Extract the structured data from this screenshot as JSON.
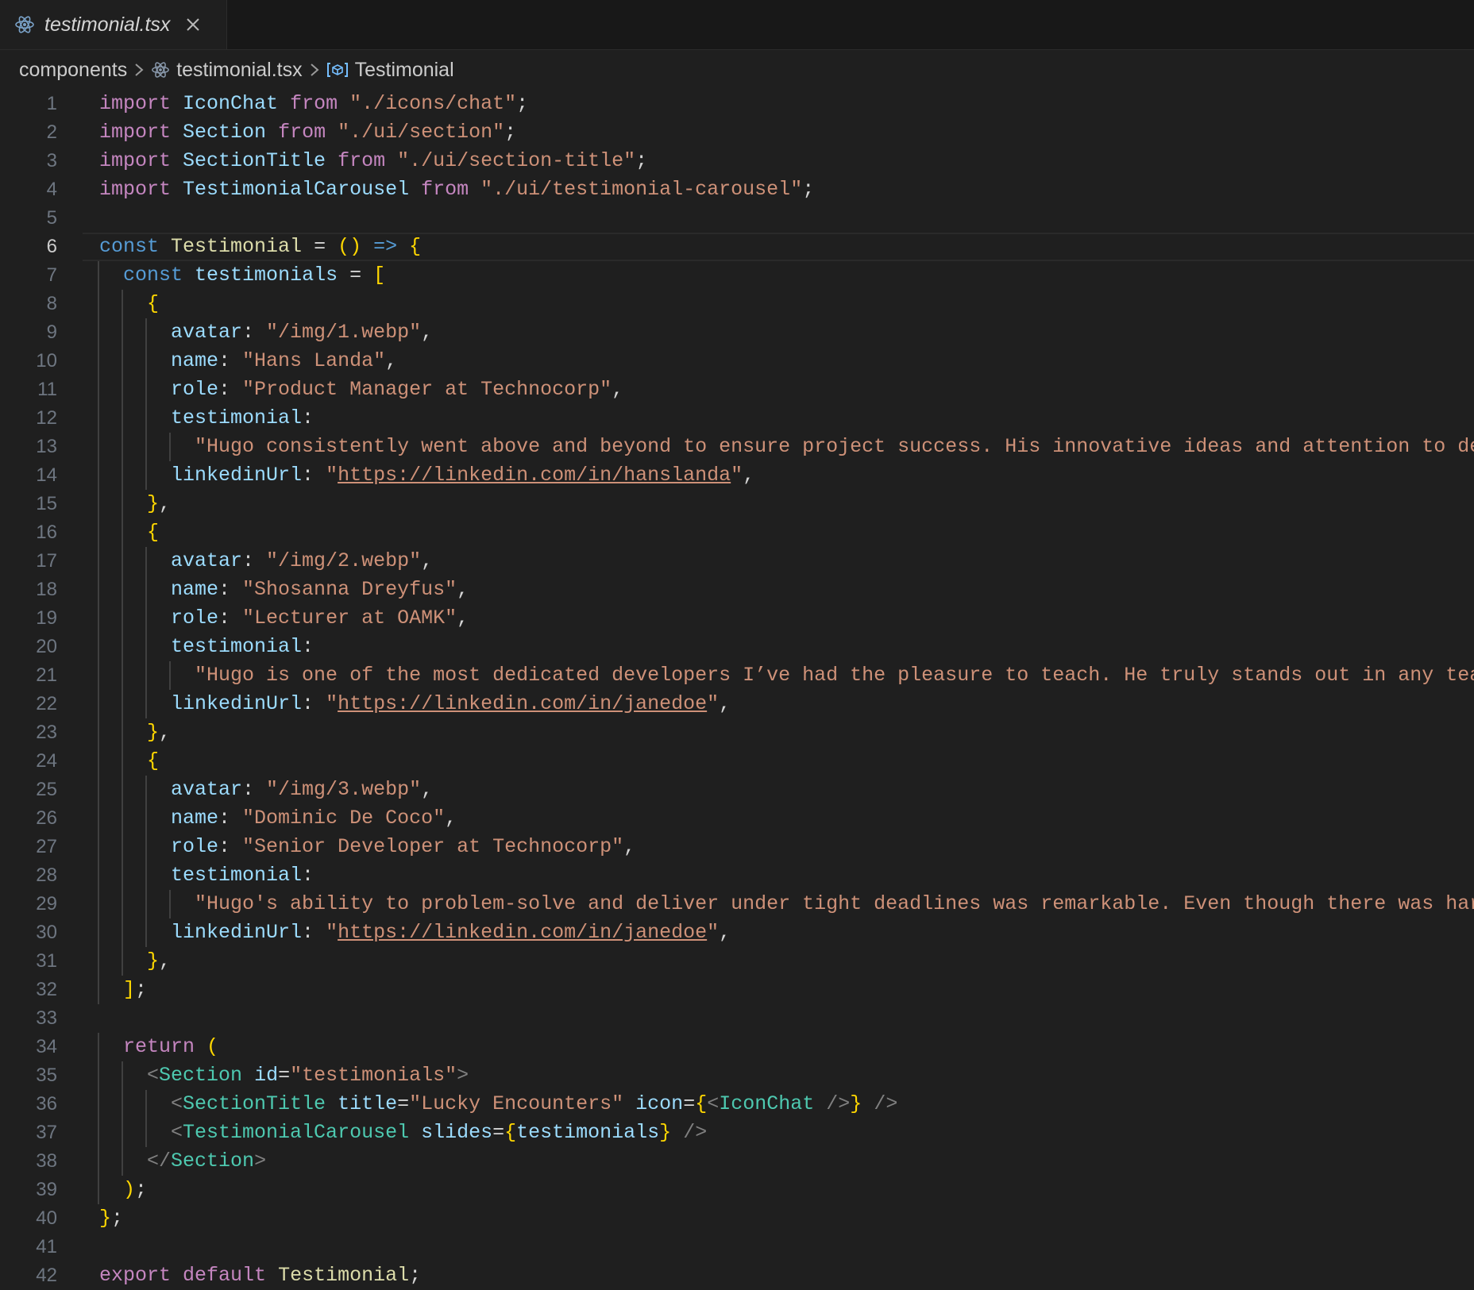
{
  "tab": {
    "title": "testimonial.tsx",
    "icon": "react-icon",
    "close_icon": "close-icon"
  },
  "breadcrumb": {
    "folder": "components",
    "file": "testimonial.tsx",
    "symbol": "Testimonial"
  },
  "editor": {
    "current_line": 6,
    "lines": [
      "import IconChat from \"./icons/chat\";",
      "import Section from \"./ui/section\";",
      "import SectionTitle from \"./ui/section-title\";",
      "import TestimonialCarousel from \"./ui/testimonial-carousel\";",
      "",
      "const Testimonial = () => {",
      "  const testimonials = [",
      "    {",
      "      avatar: \"/img/1.webp\",",
      "      name: \"Hans Landa\",",
      "      role: \"Product Manager at Technocorp\",",
      "      testimonial:",
      "        \"Hugo consistently went above and beyond to ensure project success. His innovative ideas and attention to detail",
      "      linkedinUrl: \"https://linkedin.com/in/hanslanda\",",
      "    },",
      "    {",
      "      avatar: \"/img/2.webp\",",
      "      name: \"Shosanna Dreyfus\",",
      "      role: \"Lecturer at OAMK\",",
      "      testimonial:",
      "        \"Hugo is one of the most dedicated developers I’ve had the pleasure to teach. He truly stands out in any team wi",
      "      linkedinUrl: \"https://linkedin.com/in/janedoe\",",
      "    },",
      "    {",
      "      avatar: \"/img/3.webp\",",
      "      name: \"Dominic De Coco\",",
      "      role: \"Senior Developer at Technocorp\",",
      "      testimonial:",
      "        \"Hugo's ability to problem-solve and deliver under tight deadlines was remarkable. Even though there was hard ti",
      "      linkedinUrl: \"https://linkedin.com/in/janedoe\",",
      "    },",
      "  ];",
      "",
      "  return (",
      "    <Section id=\"testimonials\">",
      "      <SectionTitle title=\"Lucky Encounters\" icon={<IconChat />} />",
      "      <TestimonialCarousel slides={testimonials} />",
      "    </Section>",
      "  );",
      "};",
      "",
      "export default Testimonial;"
    ]
  },
  "colors": {
    "background": "#1f1f1f",
    "keyword": "#c586c0",
    "string": "#ce9178",
    "identifier": "#9cdcfe",
    "tag": "#4ec9b0",
    "function": "#dcdcaa",
    "cursor_box": "#c8a21a"
  }
}
